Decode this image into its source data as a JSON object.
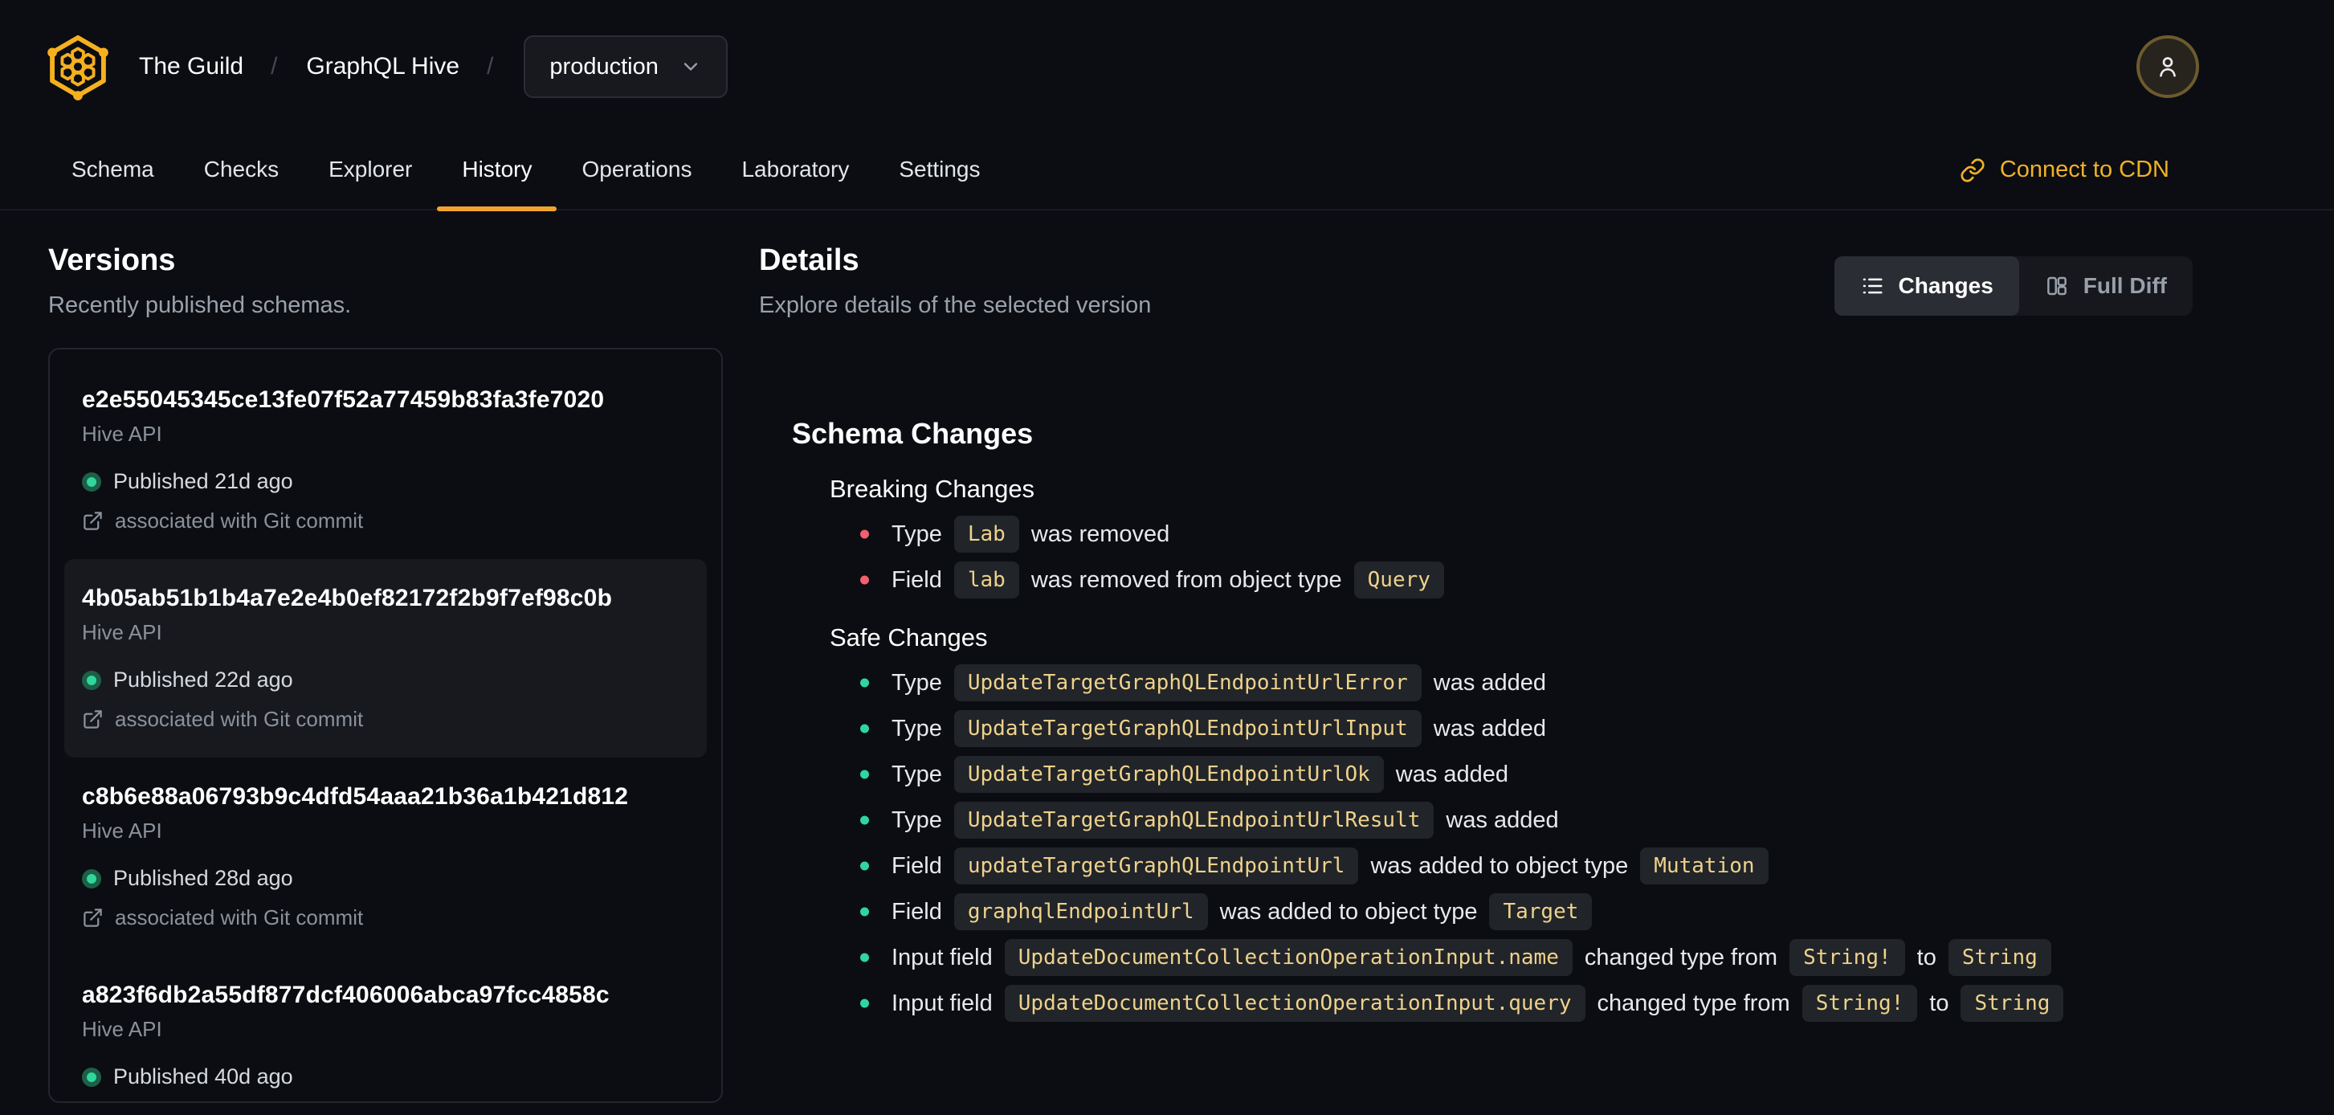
{
  "header": {
    "breadcrumb": {
      "org": "The Guild",
      "separator": "/",
      "project": "GraphQL Hive",
      "target": "production"
    },
    "nav": {
      "tabs": [
        {
          "label": "Schema",
          "active": false
        },
        {
          "label": "Checks",
          "active": false
        },
        {
          "label": "Explorer",
          "active": false
        },
        {
          "label": "History",
          "active": true
        },
        {
          "label": "Operations",
          "active": false
        },
        {
          "label": "Laboratory",
          "active": false
        },
        {
          "label": "Settings",
          "active": false
        }
      ],
      "cdn_link_label": "Connect to CDN"
    }
  },
  "versions": {
    "title": "Versions",
    "subtitle": "Recently published schemas.",
    "items": [
      {
        "hash": "e2e55045345ce13fe07f52a77459b83fa3fe7020",
        "service": "Hive API",
        "published": "Published 21d ago",
        "git": "associated with Git commit",
        "selected": false
      },
      {
        "hash": "4b05ab51b1b4a7e2e4b0ef82172f2b9f7ef98c0b",
        "service": "Hive API",
        "published": "Published 22d ago",
        "git": "associated with Git commit",
        "selected": true
      },
      {
        "hash": "c8b6e88a06793b9c4dfd54aaa21b36a1b421d812",
        "service": "Hive API",
        "published": "Published 28d ago",
        "git": "associated with Git commit",
        "selected": false
      },
      {
        "hash": "a823f6db2a55df877dcf406006abca97fcc4858c",
        "service": "Hive API",
        "published": "Published 40d ago",
        "git": null,
        "selected": false
      }
    ]
  },
  "details": {
    "title": "Details",
    "subtitle": "Explore details of the selected version",
    "view_toggle": [
      {
        "label": "Changes",
        "icon": "list-icon",
        "active": true
      },
      {
        "label": "Full Diff",
        "icon": "columns-icon",
        "active": false
      }
    ],
    "schema_changes": {
      "title": "Schema Changes",
      "sections": [
        {
          "title": "Breaking Changes",
          "severity": "breaking",
          "items": [
            {
              "parts": [
                {
                  "t": "text",
                  "v": "Type"
                },
                {
                  "t": "code",
                  "v": "Lab"
                },
                {
                  "t": "text",
                  "v": "was removed"
                }
              ]
            },
            {
              "parts": [
                {
                  "t": "text",
                  "v": "Field"
                },
                {
                  "t": "code",
                  "v": "lab"
                },
                {
                  "t": "text",
                  "v": "was removed from object type"
                },
                {
                  "t": "code",
                  "v": "Query"
                }
              ]
            }
          ]
        },
        {
          "title": "Safe Changes",
          "severity": "safe",
          "items": [
            {
              "parts": [
                {
                  "t": "text",
                  "v": "Type"
                },
                {
                  "t": "code",
                  "v": "UpdateTargetGraphQLEndpointUrlError"
                },
                {
                  "t": "text",
                  "v": "was added"
                }
              ]
            },
            {
              "parts": [
                {
                  "t": "text",
                  "v": "Type"
                },
                {
                  "t": "code",
                  "v": "UpdateTargetGraphQLEndpointUrlInput"
                },
                {
                  "t": "text",
                  "v": "was added"
                }
              ]
            },
            {
              "parts": [
                {
                  "t": "text",
                  "v": "Type"
                },
                {
                  "t": "code",
                  "v": "UpdateTargetGraphQLEndpointUrlOk"
                },
                {
                  "t": "text",
                  "v": "was added"
                }
              ]
            },
            {
              "parts": [
                {
                  "t": "text",
                  "v": "Type"
                },
                {
                  "t": "code",
                  "v": "UpdateTargetGraphQLEndpointUrlResult"
                },
                {
                  "t": "text",
                  "v": "was added"
                }
              ]
            },
            {
              "parts": [
                {
                  "t": "text",
                  "v": "Field"
                },
                {
                  "t": "code",
                  "v": "updateTargetGraphQLEndpointUrl"
                },
                {
                  "t": "text",
                  "v": "was added to object type"
                },
                {
                  "t": "code",
                  "v": "Mutation"
                }
              ]
            },
            {
              "parts": [
                {
                  "t": "text",
                  "v": "Field"
                },
                {
                  "t": "code",
                  "v": "graphqlEndpointUrl"
                },
                {
                  "t": "text",
                  "v": "was added to object type"
                },
                {
                  "t": "code",
                  "v": "Target"
                }
              ]
            },
            {
              "parts": [
                {
                  "t": "text",
                  "v": "Input field"
                },
                {
                  "t": "code",
                  "v": "UpdateDocumentCollectionOperationInput.name"
                },
                {
                  "t": "text",
                  "v": "changed type from"
                },
                {
                  "t": "code",
                  "v": "String!"
                },
                {
                  "t": "text",
                  "v": "to"
                },
                {
                  "t": "code",
                  "v": "String"
                }
              ]
            },
            {
              "parts": [
                {
                  "t": "text",
                  "v": "Input field"
                },
                {
                  "t": "code",
                  "v": "UpdateDocumentCollectionOperationInput.query"
                },
                {
                  "t": "text",
                  "v": "changed type from"
                },
                {
                  "t": "code",
                  "v": "String!"
                },
                {
                  "t": "text",
                  "v": "to"
                },
                {
                  "t": "code",
                  "v": "String"
                }
              ]
            }
          ]
        }
      ]
    }
  },
  "colors": {
    "background": "#0b0d12",
    "brand_yellow": "#f5b01f",
    "accent_amber": "#f0a42e",
    "cdn_link": "#efb127",
    "breaking_bullet": "#f0606d",
    "safe_bullet": "#2fd5a2",
    "published_green": "#2fd79b",
    "chip_text": "#eed28b",
    "chip_bg": "#212429",
    "selected_card_bg": "#17191f"
  }
}
